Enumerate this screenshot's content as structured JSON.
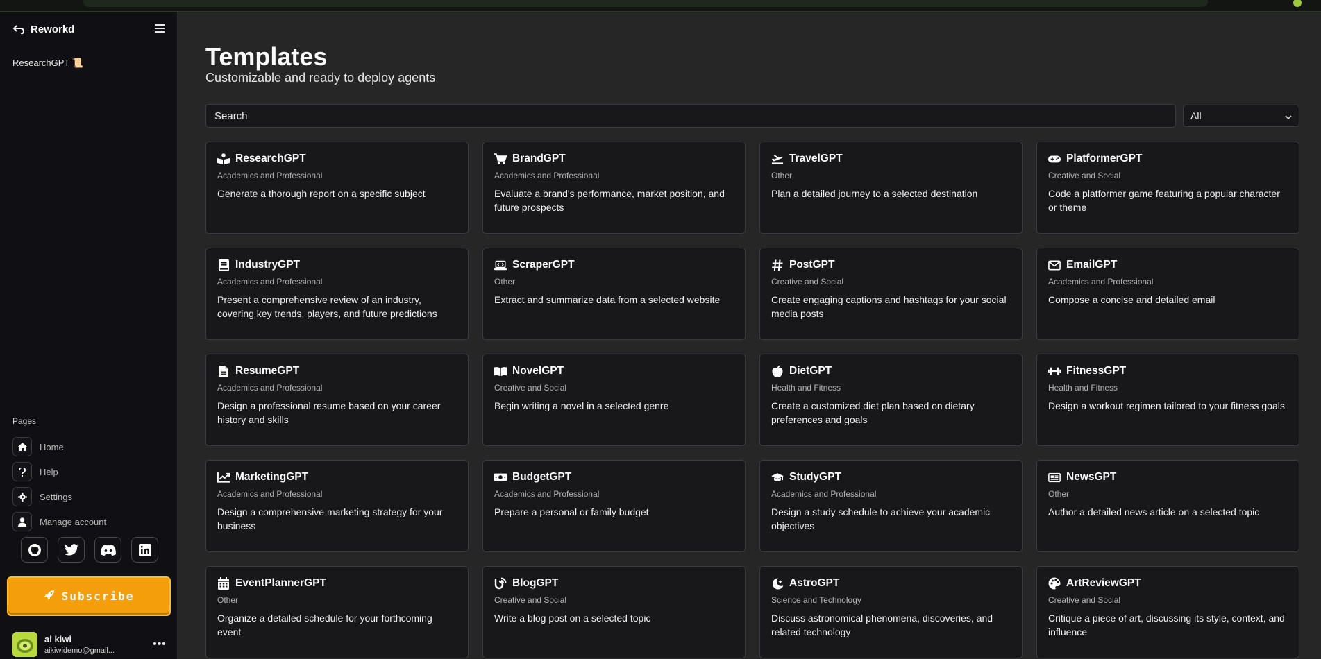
{
  "app": {
    "name": "Reworkd"
  },
  "sidebar": {
    "recent": [
      "ResearchGPT 📜"
    ],
    "pages_label": "Pages",
    "nav": [
      {
        "label": "Home",
        "icon": "home-icon"
      },
      {
        "label": "Help",
        "icon": "help-icon"
      },
      {
        "label": "Settings",
        "icon": "gear-icon"
      },
      {
        "label": "Manage account",
        "icon": "user-icon"
      }
    ],
    "socials": [
      "github-icon",
      "twitter-icon",
      "discord-icon",
      "linkedin-icon"
    ],
    "subscribe_label": "Subscribe",
    "user": {
      "name": "ai kiwi",
      "email": "aikiwidemo@gmail..."
    }
  },
  "main": {
    "title": "Templates",
    "subtitle": "Customizable and ready to deploy agents",
    "search_placeholder": "Search",
    "filter_selected": "All"
  },
  "templates": [
    {
      "name": "ResearchGPT",
      "category": "Academics and Professional",
      "description": "Generate a thorough report on a specific subject",
      "icon": "book-reader-icon"
    },
    {
      "name": "BrandGPT",
      "category": "Academics and Professional",
      "description": "Evaluate a brand's performance, market position, and future prospects",
      "icon": "cart-icon"
    },
    {
      "name": "TravelGPT",
      "category": "Other",
      "description": "Plan a detailed journey to a selected destination",
      "icon": "plane-icon"
    },
    {
      "name": "PlatformerGPT",
      "category": "Creative and Social",
      "description": "Code a platformer game featuring a popular character or theme",
      "icon": "gamepad-icon"
    },
    {
      "name": "IndustryGPT",
      "category": "Academics and Professional",
      "description": "Present a comprehensive review of an industry, covering key trends, players, and future predictions",
      "icon": "book-icon"
    },
    {
      "name": "ScraperGPT",
      "category": "Other",
      "description": "Extract and summarize data from a selected website",
      "icon": "laptop-code-icon"
    },
    {
      "name": "PostGPT",
      "category": "Creative and Social",
      "description": "Create engaging captions and hashtags for your social media posts",
      "icon": "hashtag-icon"
    },
    {
      "name": "EmailGPT",
      "category": "Academics and Professional",
      "description": "Compose a concise and detailed email",
      "icon": "envelope-icon"
    },
    {
      "name": "ResumeGPT",
      "category": "Academics and Professional",
      "description": "Design a professional resume based on your career history and skills",
      "icon": "file-icon"
    },
    {
      "name": "NovelGPT",
      "category": "Creative and Social",
      "description": "Begin writing a novel in a selected genre",
      "icon": "open-book-icon"
    },
    {
      "name": "DietGPT",
      "category": "Health and Fitness",
      "description": "Create a customized diet plan based on dietary preferences and goals",
      "icon": "apple-icon"
    },
    {
      "name": "FitnessGPT",
      "category": "Health and Fitness",
      "description": "Design a workout regimen tailored to your fitness goals",
      "icon": "dumbbell-icon"
    },
    {
      "name": "MarketingGPT",
      "category": "Academics and Professional",
      "description": "Design a comprehensive marketing strategy for your business",
      "icon": "chart-line-icon"
    },
    {
      "name": "BudgetGPT",
      "category": "Academics and Professional",
      "description": "Prepare a personal or family budget",
      "icon": "money-icon"
    },
    {
      "name": "StudyGPT",
      "category": "Academics and Professional",
      "description": "Design a study schedule to achieve your academic objectives",
      "icon": "graduation-cap-icon"
    },
    {
      "name": "NewsGPT",
      "category": "Other",
      "description": "Author a detailed news article on a selected topic",
      "icon": "newspaper-icon"
    },
    {
      "name": "EventPlannerGPT",
      "category": "Other",
      "description": "Organize a detailed schedule for your forthcoming event",
      "icon": "calendar-icon"
    },
    {
      "name": "BlogGPT",
      "category": "Creative and Social",
      "description": "Write a blog post on a selected topic",
      "icon": "blog-icon"
    },
    {
      "name": "AstroGPT",
      "category": "Science and Technology",
      "description": "Discuss astronomical phenomena, discoveries, and related technology",
      "icon": "moon-star-icon"
    },
    {
      "name": "ArtReviewGPT",
      "category": "Creative and Social",
      "description": "Critique a piece of art, discussing its style, context, and influence",
      "icon": "palette-icon"
    }
  ]
}
